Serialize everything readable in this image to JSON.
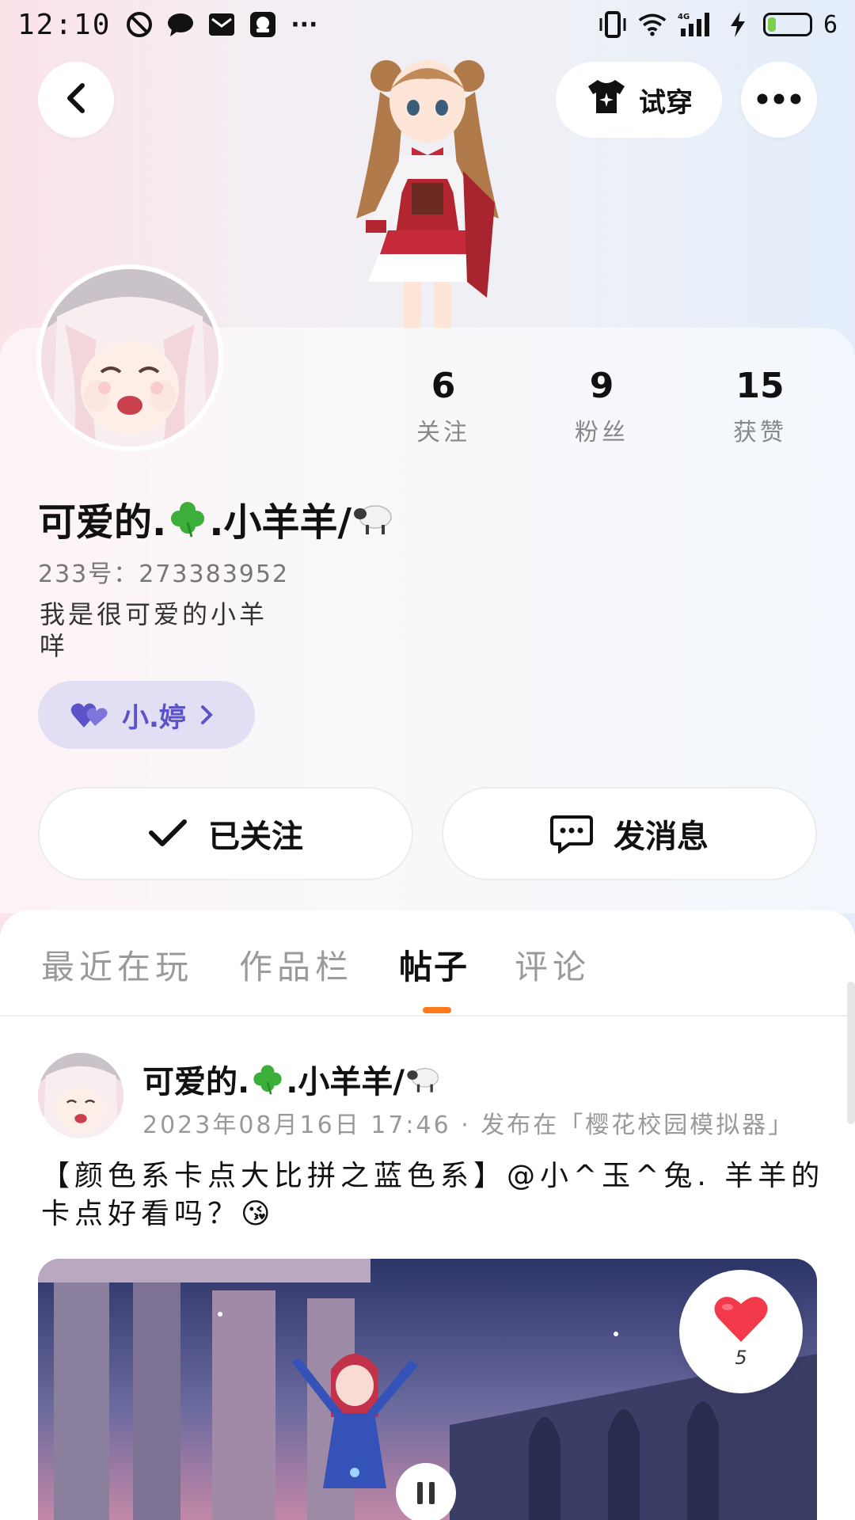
{
  "status_bar": {
    "time": "12:10",
    "battery_level": "6",
    "network": "4G"
  },
  "header": {
    "try_on_label": "试穿"
  },
  "profile": {
    "stats": [
      {
        "value": "6",
        "label": "关注"
      },
      {
        "value": "9",
        "label": "粉丝"
      },
      {
        "value": "15",
        "label": "获赞"
      }
    ],
    "username_prefix": "可爱的.",
    "username_suffix": ".小羊羊/",
    "user_id": "233号：273383952",
    "bio": "我是很可爱的小羊咩",
    "cp_tag": "小.婷",
    "followed_label": "已关注",
    "message_label": "发消息"
  },
  "tabs": [
    {
      "label": "最近在玩"
    },
    {
      "label": "作品栏"
    },
    {
      "label": "帖子"
    },
    {
      "label": "评论"
    }
  ],
  "post": {
    "author_prefix": "可爱的.",
    "author_suffix": ".小羊羊/",
    "meta": "2023年08月16日 17:46 · 发布在「樱花校园模拟器」",
    "text": "【颜色系卡点大比拼之蓝色系】@小^玉^兔. 羊羊的卡点好看吗？😘",
    "like_count": "5"
  },
  "colors": {
    "accent_orange": "#ff7a1a",
    "cp_purple": "#5c53c9",
    "cp_bg": "#e2dff4",
    "like_red": "#f23a4a"
  }
}
